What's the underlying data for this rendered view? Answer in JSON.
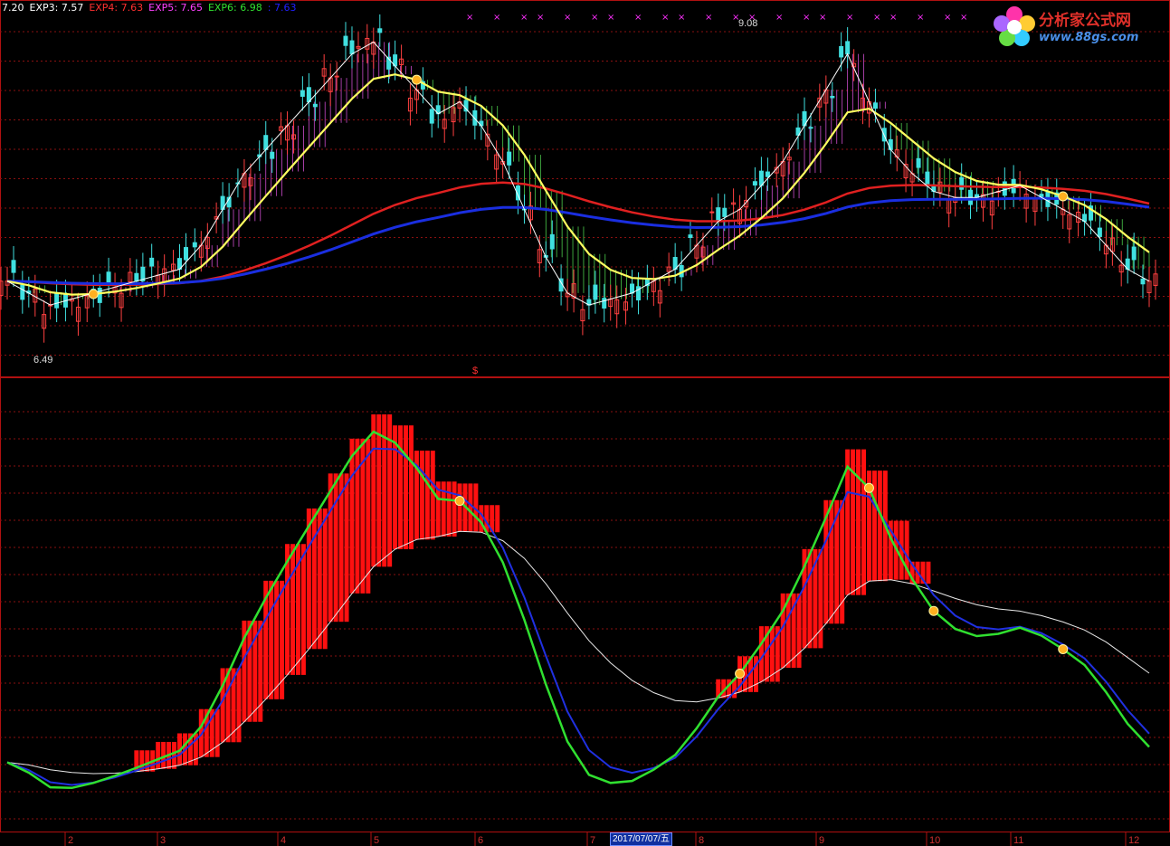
{
  "chart_data": {
    "type": "line",
    "legend": [
      {
        "label": "7.20",
        "color": "#ffffff"
      },
      {
        "label": "EXP3: 7.57",
        "color": "#ffffff"
      },
      {
        "label": "EXP4: 7.63",
        "color": "#ff3030"
      },
      {
        "label": "EXP5: 7.65",
        "color": "#ff40ff"
      },
      {
        "label": "EXP6: 6.98",
        "color": "#30e030"
      },
      {
        "label": ": 7.63",
        "color": "#2020ff"
      }
    ],
    "price_high_label": "9.08",
    "price_low_label": "6.49",
    "signal_marker": "$",
    "x_ticks": [
      "2",
      "3",
      "4",
      "5",
      "6",
      "7",
      "8",
      "9",
      "10",
      "11",
      "12"
    ],
    "cursor_date": "2017/07/07/五",
    "close": [
      7.0,
      6.9,
      6.8,
      6.85,
      6.9,
      6.95,
      7.0,
      7.05,
      7.1,
      7.3,
      7.6,
      7.9,
      8.1,
      8.3,
      8.5,
      8.7,
      8.9,
      9.0,
      8.8,
      8.6,
      8.4,
      8.5,
      8.3,
      8.0,
      7.6,
      7.2,
      6.9,
      6.8,
      6.85,
      6.9,
      7.0,
      7.1,
      7.3,
      7.5,
      7.6,
      7.8,
      8.0,
      8.3,
      8.6,
      8.9,
      8.5,
      8.1,
      7.9,
      7.75,
      7.7,
      7.7,
      7.75,
      7.8,
      7.7,
      7.6,
      7.5,
      7.3,
      7.1,
      7.0
    ],
    "colors": {
      "upper_band": "#ffff60",
      "ma_red": "#e02020",
      "ma_blue": "#1a2ee0",
      "fill_up": "#ff60ff",
      "fill_down": "#60ff60",
      "osc_green": "#30e030",
      "osc_blue": "#2030e0",
      "osc_white": "#e8e8e8",
      "osc_bar": "#ff1010"
    }
  },
  "logo": {
    "brand": "分析家公式网",
    "url": "www.88gs.com"
  }
}
